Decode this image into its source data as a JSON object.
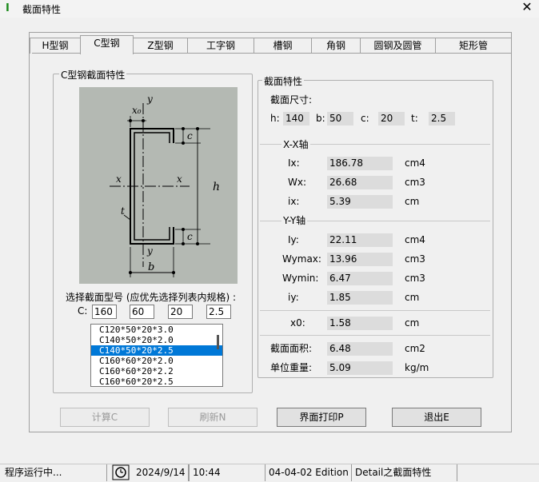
{
  "window": {
    "icon": "I",
    "title": "截面特性",
    "close": "✕"
  },
  "tabs": [
    {
      "label": "H型钢"
    },
    {
      "label": "C型钢"
    },
    {
      "label": "Z型钢"
    },
    {
      "label": "工字钢"
    },
    {
      "label": "槽钢"
    },
    {
      "label": "角钢"
    },
    {
      "label": "圆钢及圆管"
    },
    {
      "label": "矩形管"
    }
  ],
  "left_group": {
    "title": "C型钢截面特性",
    "diagram_labels": {
      "x0": "x₀",
      "y_top": "y",
      "y_bottom": "y",
      "x_left": "x",
      "x_right": "x",
      "c_top": "c",
      "c_bottom": "c",
      "h": "h",
      "t": "t",
      "b": "b"
    },
    "select_label": "选择截面型号 (应优先选择列表内规格) :",
    "c_label": "C:",
    "inputs": [
      "160",
      "60",
      "20",
      "2.5"
    ],
    "list_items": [
      "C120*50*20*3.0",
      "C140*50*20*2.0",
      "C140*50*20*2.5",
      "C160*60*20*2.0",
      "C160*60*20*2.2",
      "C160*60*20*2.5"
    ],
    "selected_index": 2
  },
  "right_group": {
    "title": "截面特性",
    "dim_title": "截面尺寸:",
    "dims": {
      "h_label": "h:",
      "h": "140",
      "b_label": "b:",
      "b": "50",
      "c_label": "c:",
      "c": "20",
      "t_label": "t:",
      "t": "2.5"
    },
    "xx_title": "X-X轴",
    "xx": [
      {
        "label": "Ix:",
        "value": "186.78",
        "unit": "cm4"
      },
      {
        "label": "Wx:",
        "value": "26.68",
        "unit": "cm3"
      },
      {
        "label": "ix:",
        "value": "5.39",
        "unit": "cm"
      }
    ],
    "yy_title": "Y-Y轴",
    "yy": [
      {
        "label": "Iy:",
        "value": "22.11",
        "unit": "cm4"
      },
      {
        "label": "Wymax:",
        "value": "13.96",
        "unit": "cm3"
      },
      {
        "label": "Wymin:",
        "value": "6.47",
        "unit": "cm3"
      },
      {
        "label": "iy:",
        "value": "1.85",
        "unit": "cm"
      }
    ],
    "x0": {
      "label": "x0:",
      "value": "1.58",
      "unit": "cm"
    },
    "area": {
      "label": "截面面积:",
      "value": "6.48",
      "unit": "cm2"
    },
    "weight": {
      "label": "单位重量:",
      "value": "5.09",
      "unit": "kg/m"
    }
  },
  "buttons": {
    "calc": "计算C",
    "refresh": "刷新N",
    "print": "界面打印P",
    "exit": "退出E"
  },
  "statusbar": {
    "status": "程序运行中...",
    "date": "2024/9/14",
    "time": "10:44",
    "edition": "04-04-02 Edition",
    "info": "Detail之截面特性"
  }
}
